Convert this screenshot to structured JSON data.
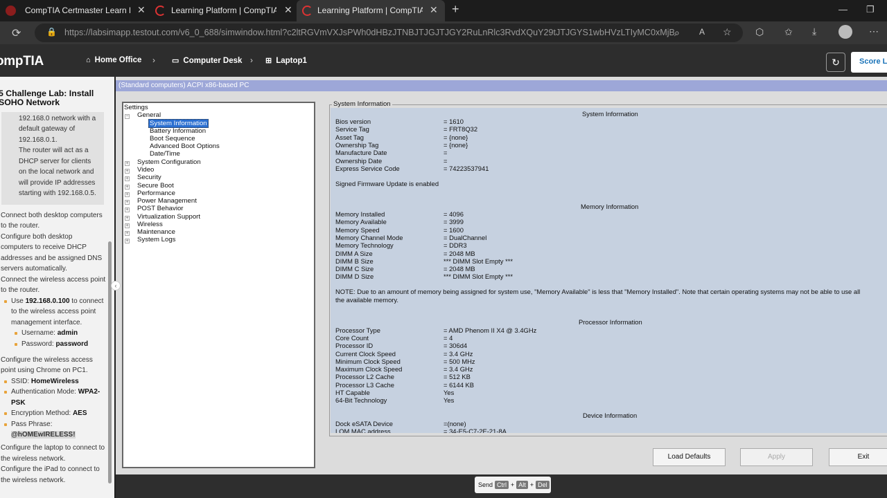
{
  "browser": {
    "tabs": [
      {
        "title": "CompTIA Certmaster Learn Link (",
        "icon": "comptia-favicon"
      },
      {
        "title": "Learning Platform | CompTIA",
        "icon": "testout-favicon"
      },
      {
        "title": "Learning Platform | CompTIA",
        "icon": "testout-favicon"
      }
    ],
    "new_tab": "+",
    "url": "https://labsimapp.testout.com/v6_0_688/simwindow.html?c2ltRGVmVXJsPWh0dHBzJTNBJTJGJTJGY2RuLnRlc3RvdXQuY29tJTJGYS1wbHVzLTIyMC0xMjB4LWVu..."
  },
  "header": {
    "logo": "ompTIA",
    "breadcrumbs": [
      "Home Office",
      "Computer Desk",
      "Laptop1"
    ],
    "score_label": "Score La"
  },
  "lab": {
    "title": "5 Challenge Lab: Install SOHO Network",
    "box_lines": [
      "192.168.0 network with a",
      "default gateway of",
      "192.168.0.1.",
      "The router will act as a",
      "DHCP server for clients",
      "on the local network and",
      "will provide IP addresses",
      "starting with 192.168.0.5."
    ],
    "lines": {
      "l1": "Connect both desktop computers",
      "l2": "to the router.",
      "l3": "Configure both desktop",
      "l4": "computers to receive DHCP",
      "l5": "addresses and be assigned DNS",
      "l6": "servers automatically.",
      "l7": "Connect the wireless access point",
      "l8": "to the router.",
      "use_pre": "Use ",
      "use_ip": "192.168.0.100",
      "use_post": " to connect",
      "l10": "to the wireless access point",
      "l11": "management interface.",
      "user_label": "Username: ",
      "user_val": "admin",
      "pass_label": "Password: ",
      "pass_val": "password",
      "l14": "Configure the wireless access",
      "l15": "point using Chrome on PC1.",
      "ssid_label": "SSID: ",
      "ssid_val": "HomeWireless",
      "auth_label": "Authentication Mode: ",
      "auth_val": "WPA2-",
      "auth_val2": "PSK",
      "enc_label": "Encryption Method: ",
      "enc_val": "AES",
      "phrase_label": "Pass Phrase:",
      "phrase_val": "@hOMEwIRELESS!",
      "l21": "Configure the laptop to connect to",
      "l22": "the wireless network.",
      "l23": "Configure the iPad to connect to",
      "l24": "the wireless network."
    }
  },
  "sim": {
    "window_title": "(Standard computers) ACPI x86-based PC",
    "tree": {
      "root": "Settings",
      "general": "General",
      "children": [
        "System Information",
        "Battery Information",
        "Boot Sequence",
        "Advanced Boot Options",
        "Date/Time"
      ],
      "others": [
        "System Configuration",
        "Video",
        "Security",
        "Secure Boot",
        "Performance",
        "Power Management",
        "POST Behavior",
        "Virtualization Support",
        "Wireless",
        "Maintenance",
        "System Logs"
      ]
    },
    "info_legend": "System Information",
    "system_title": "System Information",
    "system": [
      {
        "k": "Bios version",
        "v": "= 1610"
      },
      {
        "k": "Service Tag",
        "v": "= FRT8Q32"
      },
      {
        "k": "Asset Tag",
        "v": "= {none}"
      },
      {
        "k": "Ownership Tag",
        "v": "= {none}"
      },
      {
        "k": "Manufacture Date",
        "v": "="
      },
      {
        "k": "Ownership Date",
        "v": "="
      },
      {
        "k": "Express Service Code",
        "v": "= 74223537941"
      }
    ],
    "firmware_note": "Signed Firmware Update is enabled",
    "memory_title": "Memory Information",
    "memory": [
      {
        "k": "Memory Installed",
        "v": "= 4096"
      },
      {
        "k": "Memory Available",
        "v": "= 3999"
      },
      {
        "k": "Memory Speed",
        "v": "= 1600"
      },
      {
        "k": "Memory Channel Mode",
        "v": "= DualChannel"
      },
      {
        "k": "Memory Technology",
        "v": "= DDR3"
      },
      {
        "k": "DIMM A Size",
        "v": "= 2048 MB"
      },
      {
        "k": "DIMM B Size",
        "v": "*** DIMM Slot Empty ***"
      },
      {
        "k": "DIMM C Size",
        "v": "= 2048 MB"
      },
      {
        "k": "DIMM D Size",
        "v": "*** DIMM Slot Empty ***"
      }
    ],
    "memory_note_1": "NOTE: Due to an amount of memory being assigned for system use, \"Memory Available\" is less that \"Memory Installed\". Note that certain operating systems may not be able to use all",
    "memory_note_2": "the available memory.",
    "processor_title": "Processor Information",
    "processor": [
      {
        "k": "Processor Type",
        "v": "= AMD Phenom II X4 @ 3.4GHz"
      },
      {
        "k": "Core Count",
        "v": "= 4"
      },
      {
        "k": "Processor ID",
        "v": "= 306d4"
      },
      {
        "k": "Current Clock Speed",
        "v": "= 3.4 GHz"
      },
      {
        "k": "Minimum Clock Speed",
        "v": "= 500 MHz"
      },
      {
        "k": "Maximum Clock Speed",
        "v": "= 3.4 GHz"
      },
      {
        "k": "Processor L2 Cache",
        "v": "= 512 KB"
      },
      {
        "k": "Processor L3 Cache",
        "v": "= 6144 KB"
      },
      {
        "k": "HT Capable",
        "v": "Yes"
      },
      {
        "k": "64-Bit Technology",
        "v": "Yes"
      }
    ],
    "device_title": "Device Information",
    "device": [
      {
        "k": "Dock eSATA Device",
        "v": "=(none)"
      },
      {
        "k": "LOM MAC address",
        "v": "= 34-E5-C7-2E-21-8A"
      }
    ],
    "buttons": {
      "load_defaults": "Load Defaults",
      "apply": "Apply",
      "exit": "Exit"
    },
    "cad": {
      "send": "Send",
      "ctrl": "Ctrl",
      "alt": "Alt",
      "del": "Del",
      "plus": "+"
    }
  }
}
